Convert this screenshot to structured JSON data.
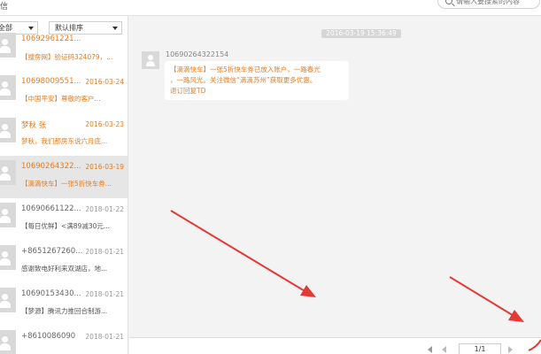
{
  "app": {
    "title": "信"
  },
  "search": {
    "placeholder": "请输入要搜索的内容"
  },
  "filters": {
    "type_label": "全部",
    "sort_label": "默认排序"
  },
  "messages": [
    {
      "sender": "10692961221...",
      "date": "",
      "preview": "【搜房网】验证码324079，...",
      "unread": true
    },
    {
      "sender": "10698009551...",
      "date": "2016-03-24",
      "preview": "【中国平安】尊敬的客户...",
      "unread": true
    },
    {
      "sender": "梦秋 张",
      "date": "2016-03-23",
      "preview": "梦秋，我们那房东说六月底...",
      "unread": true
    },
    {
      "sender": "10690264322...",
      "date": "2016-03-19",
      "preview": "【滴滴快车】一张5折快车券...",
      "unread": true
    },
    {
      "sender": "10690661122...",
      "date": "2018-01-22",
      "preview": "【每日优鲜】<满89减30元...",
      "unread": false
    },
    {
      "sender": "+8651267260...",
      "date": "2018-01-21",
      "preview": "感谢致电好利来双湖店，地...",
      "unread": false
    },
    {
      "sender": "10690153430...",
      "date": "2018-01-21",
      "preview": "【梦源】腾讯力推回合制游...",
      "unread": false
    },
    {
      "sender": "+8610086090",
      "date": "2018-01-21",
      "preview": "",
      "unread": false
    }
  ],
  "conversation": {
    "time": "2016-03-19 15:36:49",
    "sender": "10690264322154",
    "text": "【滴滴快车】一张5折快车券已放入账户，一路春光\n，一路风光。关注微信“滴滴苏州”获取更多优惠。\n退订回复TD"
  },
  "pagination": {
    "page_label": "1/1"
  },
  "colors": {
    "accent": "#e87b1f",
    "arrow": "#e53935",
    "divider_bg": "#d6d6d6"
  }
}
